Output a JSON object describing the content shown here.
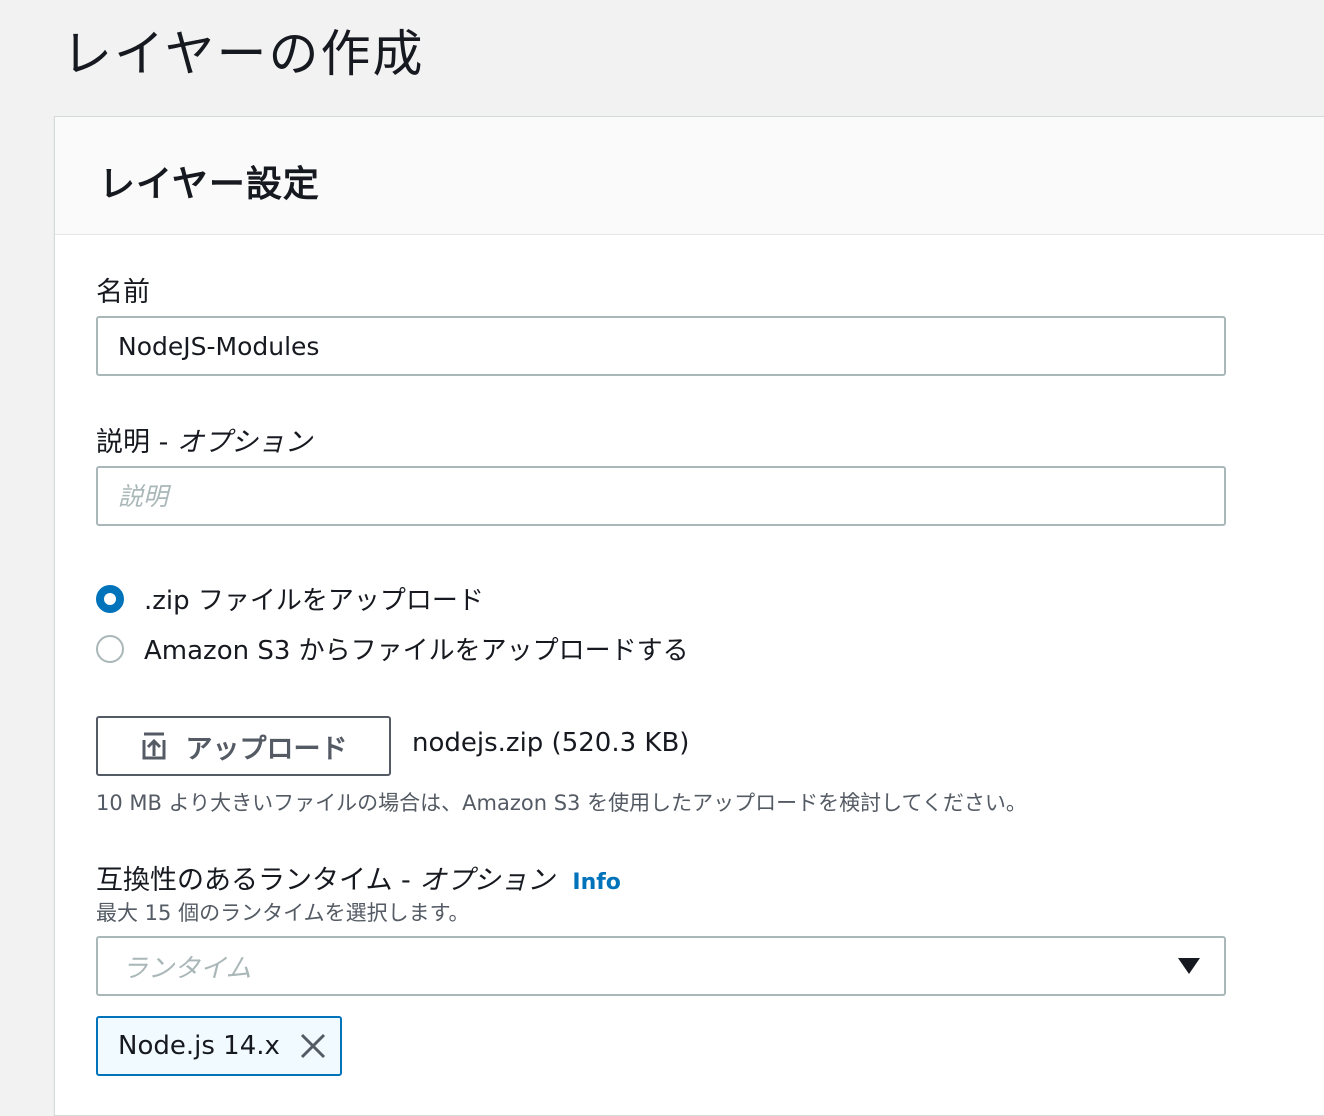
{
  "page": {
    "title": "レイヤーの作成"
  },
  "panel": {
    "title": "レイヤー設定"
  },
  "name_field": {
    "label": "名前",
    "value": "NodeJS-Modules"
  },
  "description_field": {
    "label": "説明",
    "label_suffix": " - ",
    "optional": "オプション",
    "placeholder": "説明",
    "value": ""
  },
  "upload_options": [
    {
      "label": ".zip ファイルをアップロード",
      "selected": true
    },
    {
      "label": "Amazon S3 からファイルをアップロードする",
      "selected": false
    }
  ],
  "upload": {
    "button_label": "アップロード",
    "file_info": "nodejs.zip (520.3 KB)",
    "hint": "10 MB より大きいファイルの場合は、Amazon S3 を使用したアップロードを検討してください。"
  },
  "runtimes": {
    "label": "互換性のあるランタイム",
    "label_suffix": " - ",
    "optional": "オプション",
    "info_link": "Info",
    "hint": "最大 15 個のランタイムを選択します。",
    "placeholder": "ランタイム",
    "selected": [
      "Node.js 14.x"
    ]
  },
  "colors": {
    "accent": "#0073bb",
    "border": "#aab7b8",
    "text": "#16191f",
    "muted": "#545b64",
    "background": "#f2f2f2"
  },
  "icons": {
    "upload": "upload-icon",
    "dropdown": "caret-down-icon",
    "remove": "close-icon"
  }
}
